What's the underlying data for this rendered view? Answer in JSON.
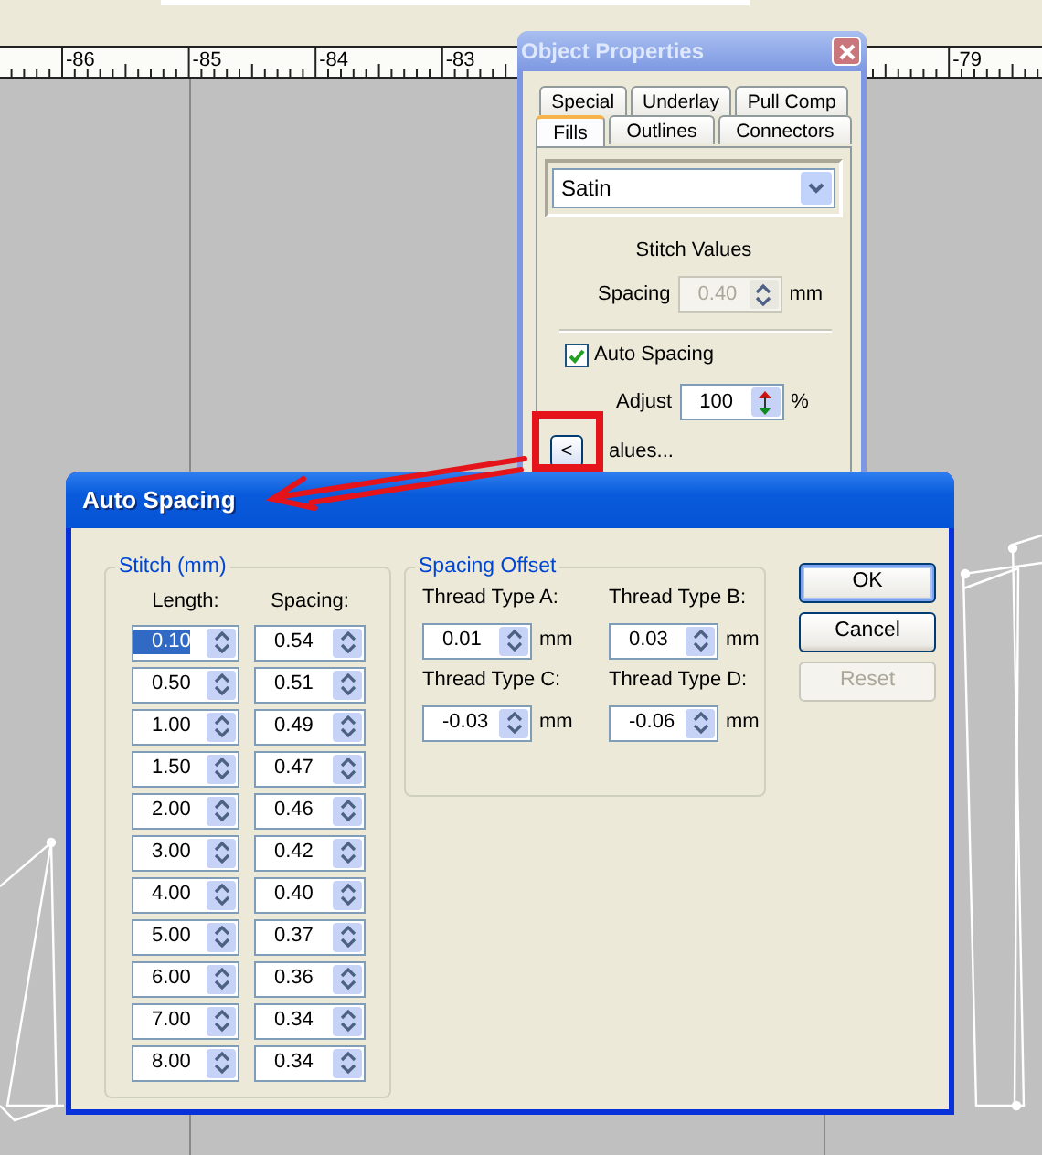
{
  "top_field": {
    "kind": "field"
  },
  "ruler": {
    "labels": [
      "-86",
      "-85",
      "-84",
      "-83",
      "-79"
    ]
  },
  "object_properties": {
    "title": "Object Properties",
    "tab_rows": [
      [
        {
          "label": "Special",
          "selected": false
        },
        {
          "label": "Underlay",
          "selected": false
        },
        {
          "label": "Pull Comp",
          "selected": false
        }
      ],
      [
        {
          "label": "Fills",
          "selected": true
        },
        {
          "label": "Outlines",
          "selected": false
        },
        {
          "label": "Connectors",
          "selected": false
        }
      ]
    ],
    "fill_type": "Satin",
    "section_label": "Stitch Values",
    "spacing": {
      "label": "Spacing",
      "value": "0.40",
      "unit": "mm",
      "disabled": true
    },
    "auto_spacing": {
      "label": "Auto Spacing",
      "checked": true
    },
    "adjust": {
      "label": "Adjust",
      "value": "100",
      "unit": "%"
    },
    "collapse_button": "<",
    "values_label": "alues..."
  },
  "dialog": {
    "title": "Auto Spacing",
    "stitch_group": {
      "title": "Stitch (mm)",
      "columns": [
        "Length:",
        "Spacing:"
      ],
      "rows": [
        {
          "length": "0.10",
          "spacing": "0.54",
          "selected": true
        },
        {
          "length": "0.50",
          "spacing": "0.51",
          "selected": false
        },
        {
          "length": "1.00",
          "spacing": "0.49",
          "selected": false
        },
        {
          "length": "1.50",
          "spacing": "0.47",
          "selected": false
        },
        {
          "length": "2.00",
          "spacing": "0.46",
          "selected": false
        },
        {
          "length": "3.00",
          "spacing": "0.42",
          "selected": false
        },
        {
          "length": "4.00",
          "spacing": "0.40",
          "selected": false
        },
        {
          "length": "5.00",
          "spacing": "0.37",
          "selected": false
        },
        {
          "length": "6.00",
          "spacing": "0.36",
          "selected": false
        },
        {
          "length": "7.00",
          "spacing": "0.34",
          "selected": false
        },
        {
          "length": "8.00",
          "spacing": "0.34",
          "selected": false
        }
      ]
    },
    "offset_group": {
      "title": "Spacing Offset",
      "fields": [
        {
          "label": "Thread Type A:",
          "value": "0.01",
          "unit": "mm"
        },
        {
          "label": "Thread Type B:",
          "value": "0.03",
          "unit": "mm"
        },
        {
          "label": "Thread Type C:",
          "value": "-0.03",
          "unit": "mm"
        },
        {
          "label": "Thread Type D:",
          "value": "-0.06",
          "unit": "mm"
        }
      ]
    },
    "buttons": [
      {
        "label": "OK",
        "default": true,
        "disabled": false
      },
      {
        "label": "Cancel",
        "default": false,
        "disabled": false
      },
      {
        "label": "Reset",
        "default": false,
        "disabled": true
      }
    ]
  }
}
